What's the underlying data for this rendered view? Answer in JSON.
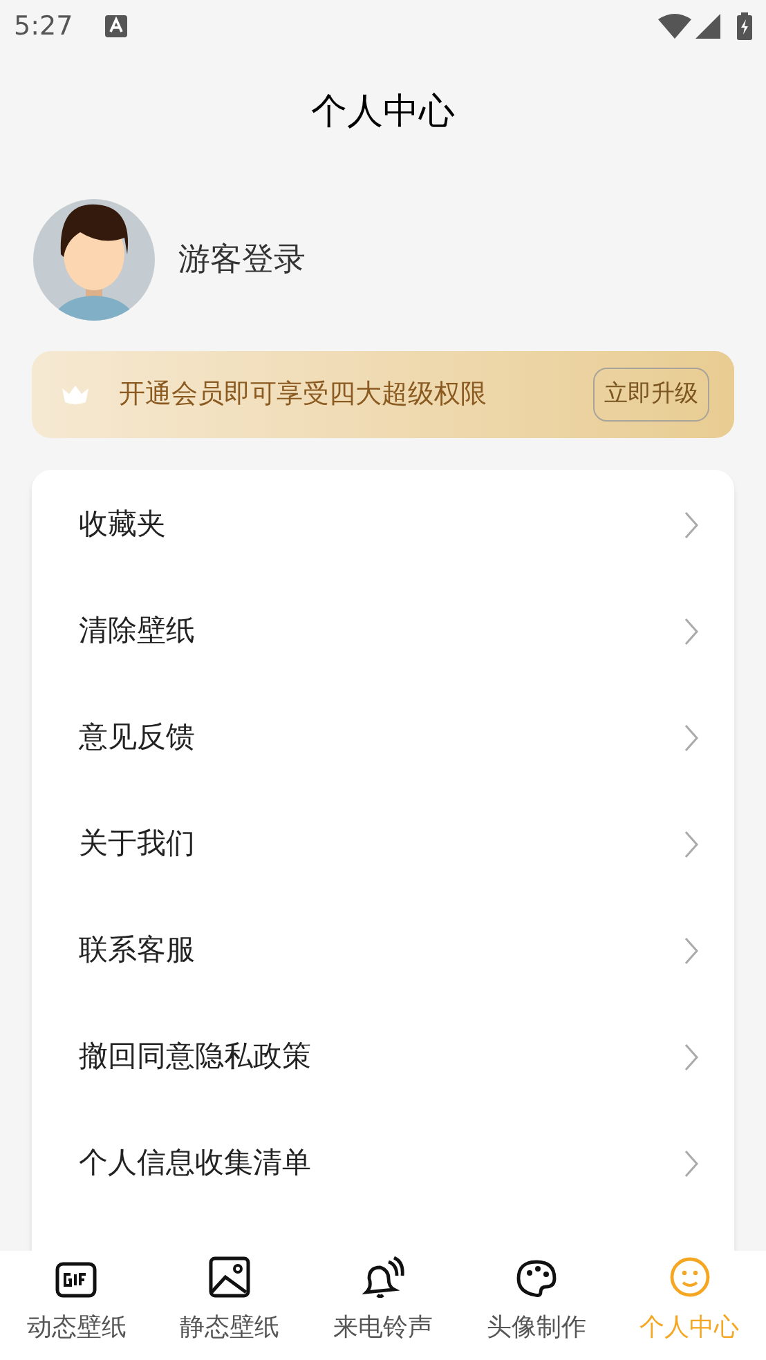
{
  "status_bar": {
    "time": "5:27"
  },
  "header": {
    "title": "个人中心"
  },
  "profile": {
    "name": "游客登录"
  },
  "vip_banner": {
    "text": "开通会员即可享受四大超级权限",
    "button": "立即升级"
  },
  "menu": [
    {
      "label": "收藏夹"
    },
    {
      "label": "清除壁纸"
    },
    {
      "label": "意见反馈"
    },
    {
      "label": "关于我们"
    },
    {
      "label": "联系客服"
    },
    {
      "label": "撤回同意隐私政策"
    },
    {
      "label": "个人信息收集清单"
    }
  ],
  "tabs": [
    {
      "kind": "gif",
      "label": "动态壁纸",
      "selected": false
    },
    {
      "kind": "image",
      "label": "静态壁纸",
      "selected": false
    },
    {
      "kind": "bell",
      "label": "来电铃声",
      "selected": false
    },
    {
      "kind": "palette",
      "label": "头像制作",
      "selected": false
    },
    {
      "kind": "smile",
      "label": "个人中心",
      "selected": true
    }
  ]
}
